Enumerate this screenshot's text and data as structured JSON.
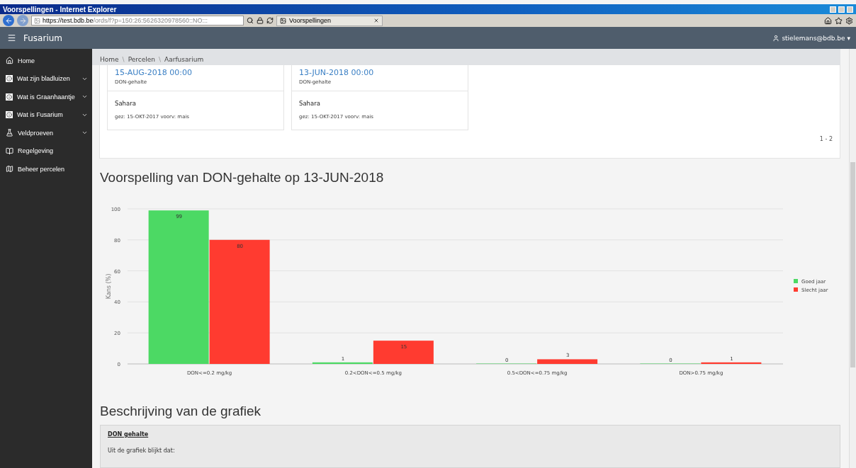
{
  "browser": {
    "title": "Voorspellingen - Internet Explorer",
    "address_host": "https://test.bdb.be",
    "address_path": "/ords/f?p=150:26:5626320978560::NO:::",
    "tab_label": "Voorspellingen"
  },
  "app": {
    "title": "Fusarium",
    "user": "stielemans@bdb.be",
    "user_caret": "▾"
  },
  "sidebar": {
    "items": [
      {
        "label": "Home",
        "kind": "home",
        "expandable": false
      },
      {
        "label": "Wat zijn bladluizen",
        "kind": "info",
        "expandable": true
      },
      {
        "label": "Wat is Graanhaantje",
        "kind": "info",
        "expandable": true
      },
      {
        "label": "Wat is Fusarium",
        "kind": "info",
        "expandable": true
      },
      {
        "label": "Veldproeven",
        "kind": "flask",
        "expandable": true
      },
      {
        "label": "Regelgeving",
        "kind": "book",
        "expandable": false
      },
      {
        "label": "Beheer percelen",
        "kind": "map",
        "expandable": false
      }
    ]
  },
  "breadcrumb": [
    "Home",
    "Percelen",
    "Aarfusarium"
  ],
  "breadcrumb_separator": "\\",
  "cards": [
    {
      "date": "15-AUG-2018 00:00",
      "type": "DON-gehalte",
      "name": "Sahara",
      "meta": "gez: 15-OKT-2017 voorv: mais"
    },
    {
      "date": "13-JUN-2018 00:00",
      "type": "DON-gehalte",
      "name": "Sahara",
      "meta": "gez: 15-OKT-2017 voorv: mais"
    }
  ],
  "pagination": "1 - 2",
  "forecast": {
    "heading": "Voorspelling van DON-gehalte op 13-JUN-2018",
    "chart_data": {
      "type": "bar",
      "ylabel": "Kans (%)",
      "categories": [
        "DON<=0.2 mg/kg",
        "0.2<DON<=0.5 mg/kg",
        "0.5<DON<=0.75 mg/kg",
        "DON>0.75 mg/kg"
      ],
      "series": [
        {
          "name": "Goed jaar",
          "color": "#4cd964",
          "values": [
            99,
            1,
            0,
            0
          ]
        },
        {
          "name": "Slecht jaar",
          "color": "#ff3b30",
          "values": [
            80,
            15,
            3,
            1
          ]
        }
      ],
      "ylim": [
        0,
        100
      ],
      "yticks": [
        0,
        20,
        40,
        60,
        80,
        100
      ],
      "data_labels": true,
      "grid": true,
      "legend": true
    }
  },
  "description": {
    "heading": "Beschrijving van de grafiek",
    "title": "DON gehalte",
    "intro": "Uit de grafiek blijkt dat:"
  }
}
